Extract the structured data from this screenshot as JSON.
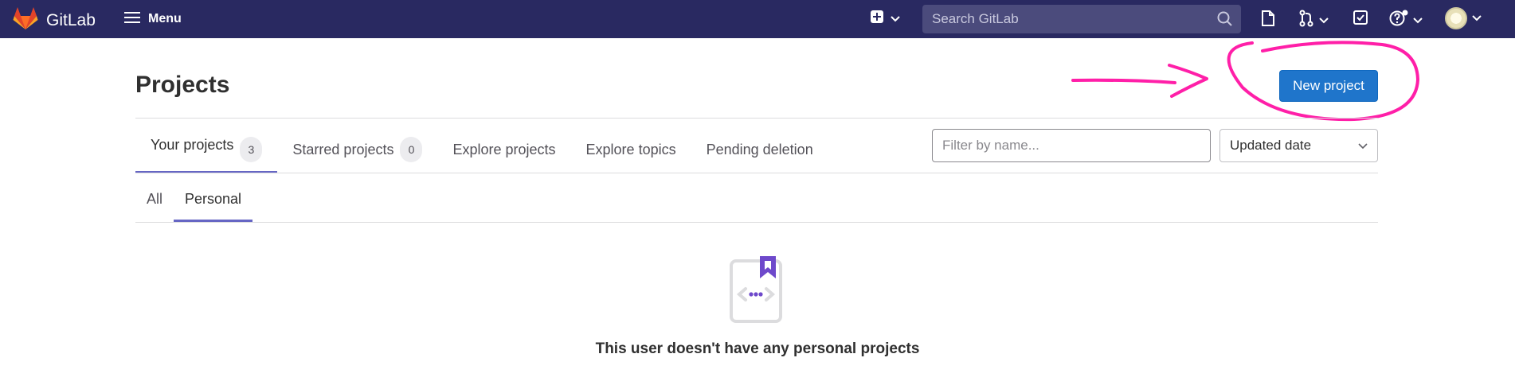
{
  "navbar": {
    "brand": "GitLab",
    "menu_label": "Menu",
    "search_placeholder": "Search GitLab",
    "icons": [
      "gitlab-logo-icon",
      "hamburger-icon",
      "plus-square-icon",
      "chevron-down-icon",
      "search-icon",
      "issues-icon",
      "merge-request-icon",
      "todo-icon",
      "help-icon",
      "avatar"
    ],
    "colors": {
      "bg": "#292961",
      "search_bg": "#4b4b7c"
    }
  },
  "page": {
    "title": "Projects",
    "new_project_label": "New project",
    "annotation": "pink hand-drawn arrow and circle highlighting New project button"
  },
  "tabs": [
    {
      "label": "Your projects",
      "count": "3",
      "active": true
    },
    {
      "label": "Starred projects",
      "count": "0",
      "active": false
    },
    {
      "label": "Explore projects",
      "active": false
    },
    {
      "label": "Explore topics",
      "active": false
    },
    {
      "label": "Pending deletion",
      "active": false
    }
  ],
  "filter": {
    "placeholder": "Filter by name..."
  },
  "sort": {
    "selected": "Updated date"
  },
  "subtabs": [
    {
      "label": "All",
      "active": false
    },
    {
      "label": "Personal",
      "active": true
    }
  ],
  "empty_state": {
    "message": "This user doesn't have any personal projects"
  },
  "colors": {
    "primary": "#1f75cb",
    "tab_indicator": "#6666c4",
    "annotation": "#ff1fa8"
  }
}
